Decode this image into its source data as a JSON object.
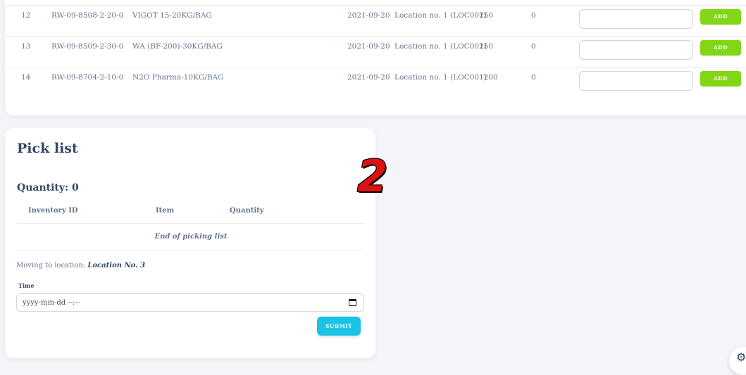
{
  "inventory_rows": [
    {
      "no": "12",
      "inventory_id": "RW-09-8508-2-20-0",
      "item": "VIGOT 15-20KG/BAG",
      "date": "2021-09-20",
      "location": "Location no. 1 (LOC001)",
      "available": "250",
      "picked": "0",
      "add_label": "ADD"
    },
    {
      "no": "13",
      "inventory_id": "RW-09-8509-2-30-0",
      "item": "WA (BF-200)-30KG/BAG",
      "date": "2021-09-20",
      "location": "Location no. 1 (LOC001)",
      "available": "250",
      "picked": "0",
      "add_label": "ADD"
    },
    {
      "no": "14",
      "inventory_id": "RW-09-8704-2-10-0",
      "item": "N2O Pharma-10KG/BAG",
      "date": "2021-09-20",
      "location": "Location no. 1 (LOC001)",
      "available": "1200",
      "picked": "0",
      "add_label": "ADD"
    }
  ],
  "pick_list": {
    "title": "Pick list",
    "quantity_label": "Quantity:",
    "quantity_value": "0",
    "columns": [
      "Inventory ID",
      "Item",
      "Quantity"
    ],
    "end_text": "End of picking list",
    "moving_label": "Moving to location:",
    "moving_location": "Location No. 3",
    "time_label": "Time",
    "time_placeholder": "yyyy-mm-dd --:--",
    "submit_label": "SUBMIT"
  },
  "annotation": {
    "step_number": "2"
  },
  "icons": {
    "calendar": "calendar-icon",
    "settings": "gear-icon"
  },
  "colors": {
    "add_button": "#82d616",
    "submit_button": "#1ac2e6",
    "annotation": "#e01010"
  }
}
